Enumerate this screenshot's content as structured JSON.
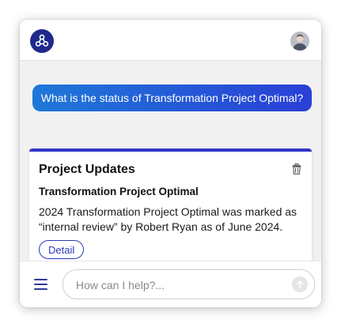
{
  "header": {
    "logo_icon": "app-logo-icon",
    "avatar_icon": "user-avatar"
  },
  "chat": {
    "user_message": "What is the status of Transformation Project Optimal?",
    "card": {
      "title": "Project Updates",
      "subtitle": "Transformation Project Optimal",
      "body": "2024 Transformation Project Optimal was marked as “internal review” by Robert Ryan as of June 2024.",
      "detail_label": "Detail",
      "delete_icon": "trash-icon"
    }
  },
  "footer": {
    "menu_icon": "menu-icon",
    "input_placeholder": "How can I help?...",
    "input_value": "",
    "send_icon": "arrow-up-icon"
  },
  "colors": {
    "brand": "#1f2a8a",
    "accent": "#3236c9",
    "bubble_start": "#1e78d8",
    "bubble_end": "#2a3fd6"
  }
}
